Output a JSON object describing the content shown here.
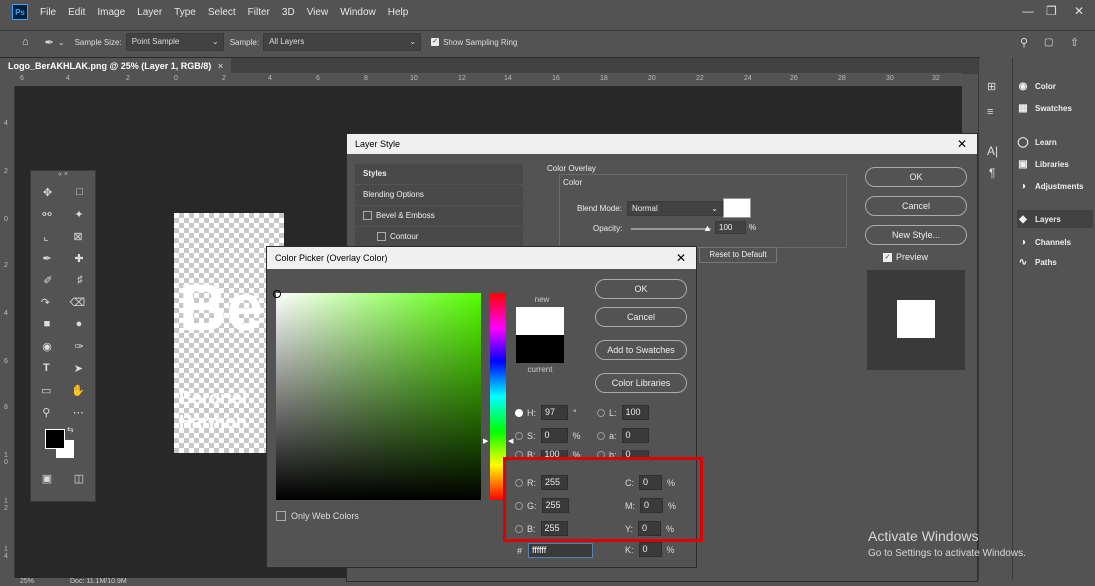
{
  "app": {
    "logo": "Ps",
    "menu": [
      "File",
      "Edit",
      "Image",
      "Layer",
      "Type",
      "Select",
      "Filter",
      "3D",
      "View",
      "Window",
      "Help"
    ]
  },
  "options": {
    "sample_size_label": "Sample Size:",
    "sample_size_value": "Point Sample",
    "sample_label": "Sample:",
    "sample_value": "All Layers",
    "show_ring_label": "Show Sampling Ring"
  },
  "document": {
    "tab_title": "Logo_BerAKHLAK.png @ 25% (Layer 1, RGB/8)",
    "tab_close": "×"
  },
  "ruler": {
    "h_ticks": [
      "6",
      "4",
      "2",
      "0",
      "2",
      "4",
      "6",
      "8",
      "10",
      "12",
      "14",
      "16",
      "18",
      "20",
      "22",
      "24",
      "26",
      "28",
      "30",
      "32"
    ],
    "v_ticks": [
      "4",
      "2",
      "0",
      "2",
      "4",
      "6",
      "8",
      "1 0",
      "1 2",
      "1 4"
    ]
  },
  "status": {
    "zoom": "25%",
    "doc": "Doc: 11.1M/10.9M"
  },
  "canvas_art": {
    "big_letters": "Be",
    "line1": "Beroriel",
    "line2": "Harmon"
  },
  "panels": {
    "items": [
      {
        "label": "Color",
        "icon": "palette-icon"
      },
      {
        "label": "Swatches",
        "icon": "grid-icon"
      },
      {
        "label": "Learn",
        "icon": "bulb-icon"
      },
      {
        "label": "Libraries",
        "icon": "library-icon"
      },
      {
        "label": "Adjustments",
        "icon": "half-circle-icon"
      },
      {
        "label": "Layers",
        "icon": "layers-icon"
      },
      {
        "label": "Channels",
        "icon": "channels-icon"
      },
      {
        "label": "Paths",
        "icon": "paths-icon"
      }
    ]
  },
  "layer_style": {
    "title": "Layer Style",
    "styles_header": "Styles",
    "rows": [
      "Blending Options",
      "Bevel & Emboss",
      "Contour"
    ],
    "section": "Color Overlay",
    "subsection": "Color",
    "blend_mode_label": "Blend Mode:",
    "blend_mode_value": "Normal",
    "opacity_label": "Opacity:",
    "opacity_value": "100",
    "opacity_unit": "%",
    "reset_label": "Reset to Default",
    "ok": "OK",
    "cancel": "Cancel",
    "new_style": "New Style...",
    "preview_label": "Preview"
  },
  "color_picker": {
    "title": "Color Picker (Overlay Color)",
    "new_label": "new",
    "current_label": "current",
    "ok": "OK",
    "cancel": "Cancel",
    "add_swatches": "Add to Swatches",
    "color_libraries": "Color Libraries",
    "only_web": "Only Web Colors",
    "H": {
      "label": "H:",
      "value": "97",
      "unit": "°"
    },
    "S": {
      "label": "S:",
      "value": "0",
      "unit": "%"
    },
    "Bv": {
      "label": "B:",
      "value": "100",
      "unit": "%"
    },
    "R": {
      "label": "R:",
      "value": "255"
    },
    "G": {
      "label": "G:",
      "value": "255"
    },
    "B": {
      "label": "B:",
      "value": "255"
    },
    "L": {
      "label": "L:",
      "value": "100"
    },
    "a": {
      "label": "a:",
      "value": "0"
    },
    "b": {
      "label": "b:",
      "value": "0"
    },
    "C": {
      "label": "C:",
      "value": "0",
      "unit": "%"
    },
    "M": {
      "label": "M:",
      "value": "0",
      "unit": "%"
    },
    "Y": {
      "label": "Y:",
      "value": "0",
      "unit": "%"
    },
    "K": {
      "label": "K:",
      "value": "0",
      "unit": "%"
    },
    "hex_label": "#",
    "hex_value": "ffffff"
  },
  "watermark": {
    "line1": "Activate Windows",
    "line2": "Go to Settings to activate Windows."
  },
  "colors": {
    "accent_red": "#e00000",
    "new_color": "#ffffff",
    "current_color": "#000000"
  }
}
